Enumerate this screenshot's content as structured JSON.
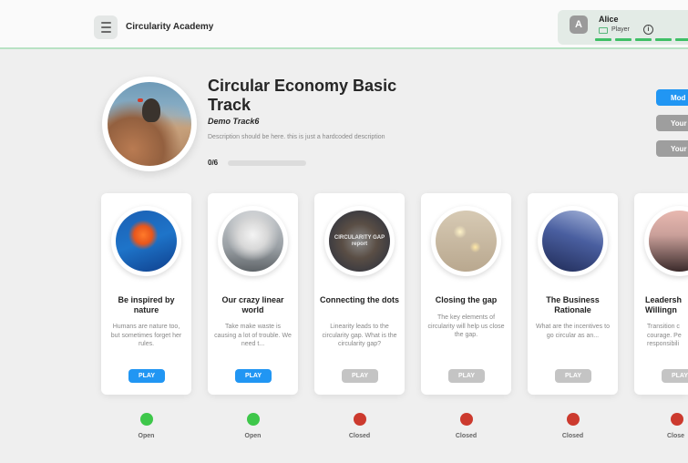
{
  "header": {
    "app_title": "Circularity Academy",
    "user": {
      "initial": "A",
      "name": "Alice",
      "role": "Player",
      "progress_segments": 5
    }
  },
  "track": {
    "title": "Circular Economy Basic Track",
    "subtitle": "Demo Track6",
    "description": "Description should be here. this is just a hardcoded description",
    "progress_text": "0/6",
    "progress": 0
  },
  "side_buttons": [
    "Mod",
    "Your",
    "Your"
  ],
  "modules": [
    {
      "title": "Be inspired by nature",
      "description": "Humans are nature too, but sometimes forget her rules.",
      "play": "PLAY",
      "enabled": true,
      "status": "Open"
    },
    {
      "title": "Our crazy linear world",
      "description": "Take make waste is causing a lot of trouble. We need t...",
      "play": "PLAY",
      "enabled": true,
      "status": "Open"
    },
    {
      "title": "Connecting the dots",
      "description": "Linearity leads to the circularity gap. What is the circularity gap?",
      "play": "PLAY",
      "enabled": false,
      "status": "Closed",
      "image_text": "CIRCULARITY GAP report"
    },
    {
      "title": "Closing the gap",
      "description": "The key elements of circularity will help us close the gap.",
      "play": "PLAY",
      "enabled": false,
      "status": "Closed"
    },
    {
      "title": "The Business Rationale",
      "description": "What are the incentives to go circular as an...",
      "play": "PLAY",
      "enabled": false,
      "status": "Closed"
    },
    {
      "title": "Leadersh Willingn",
      "description": "Transition c courage. Pe responsibili",
      "play": "PLAY",
      "enabled": false,
      "status": "Close"
    }
  ]
}
